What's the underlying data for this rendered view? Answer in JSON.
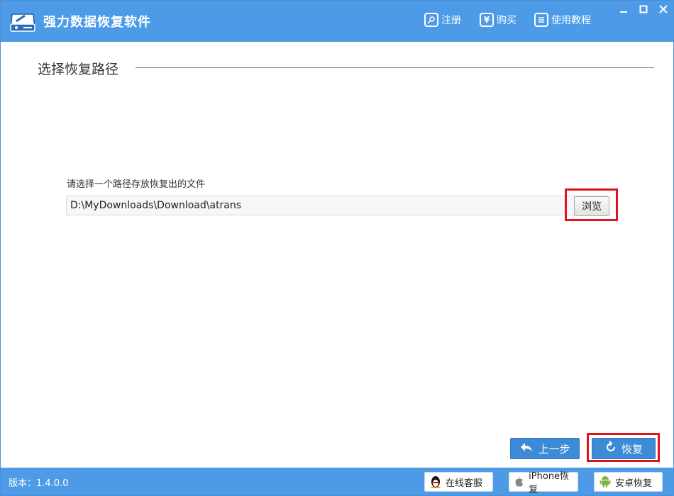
{
  "app": {
    "title": "强力数据恢复软件"
  },
  "header": {
    "register_label": "注册",
    "buy_label": "购买",
    "tutorial_label": "使用教程",
    "buy_symbol": "¥"
  },
  "window_controls": {
    "minimize": "—",
    "maximize": "☐",
    "close": "✕"
  },
  "section": {
    "title": "选择恢复路径"
  },
  "path": {
    "label": "请选择一个路径存放恢复出的文件",
    "value": "D:\\MyDownloads\\Download\\atrans",
    "browse_label": "浏览"
  },
  "actions": {
    "prev_label": "上一步",
    "restore_label": "恢复"
  },
  "status": {
    "version_text": "版本：1.4.0.0",
    "online_service_label": "在线客服",
    "iphone_label": "iPhone恢复",
    "android_label": "安卓恢复"
  },
  "colors": {
    "accent": "#4d9be6",
    "button": "#3d8bd6",
    "highlight": "#e0121c"
  },
  "icons": [
    "hard-drive-icon",
    "key-icon",
    "yen-icon",
    "document-icon",
    "back-arrow-icon",
    "refresh-icon",
    "qq-penguin-icon",
    "apple-icon",
    "android-icon"
  ]
}
